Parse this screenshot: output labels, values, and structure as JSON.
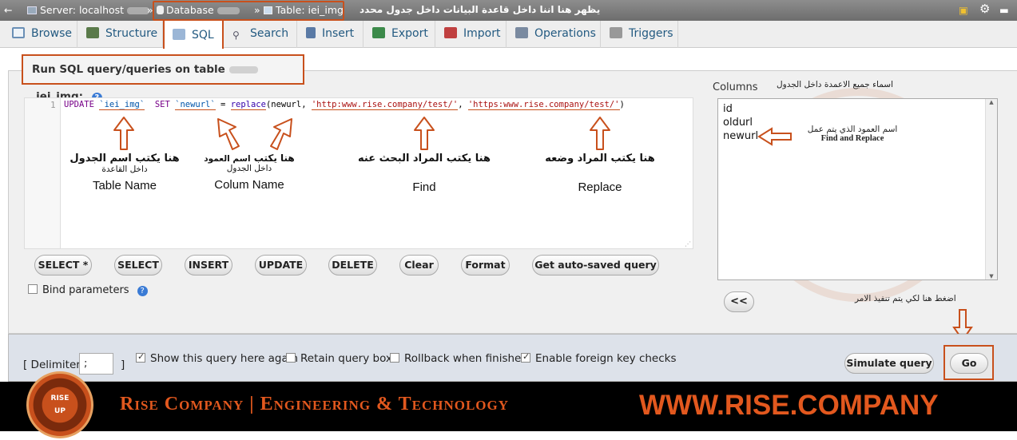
{
  "topbar": {
    "server": "Server: localhost",
    "database": "Database",
    "table": "Table: iei_img",
    "separator": "»",
    "arabic_note": "يظهر هنا اننا داخل قاعدة البيانات داخل جدول محدد"
  },
  "tabs": [
    {
      "label": "Browse",
      "icon": "browse-icon"
    },
    {
      "label": "Structure",
      "icon": "structure-icon"
    },
    {
      "label": "SQL",
      "icon": "sql-icon"
    },
    {
      "label": "Search",
      "icon": "search-icon"
    },
    {
      "label": "Insert",
      "icon": "insert-icon"
    },
    {
      "label": "Export",
      "icon": "export-icon"
    },
    {
      "label": "Import",
      "icon": "import-icon"
    },
    {
      "label": "Operations",
      "icon": "operations-icon"
    },
    {
      "label": "Triggers",
      "icon": "triggers-icon"
    }
  ],
  "active_tab": "SQL",
  "query": {
    "title_prefix": "Run SQL query/queries on table",
    "title_suffix": ".iei_img:",
    "line_number": "1",
    "code": {
      "kw_update": "UPDATE",
      "table": "`iei_img`",
      "kw_set": "SET",
      "column": "`newurl`",
      "eq": "=",
      "func": "replace",
      "arg_open": "(newurl,",
      "find": "'http:www.rise.company/test/'",
      "comma": ",",
      "replace_with": "'https:www.rise.company/test/'",
      "close": ")"
    }
  },
  "annotations": {
    "table": {
      "ar": "هنا يكتب اسم الجدول",
      "ar_sub": "داخل القاعدة",
      "en": "Table Name"
    },
    "column": {
      "ar_top": "اسم العمود",
      "ar": "هنا يكتب",
      "ar_sub": "داخل الجدول",
      "en": "Colum  Name"
    },
    "find": {
      "ar": "هنا يكتب المراد البحث عنه",
      "en": "Find"
    },
    "replace": {
      "ar": "هنا يكتب المراد وضعه",
      "en": "Replace"
    },
    "columns_header": "اسماء جميع الاعمدة داخل الجدول",
    "column_target_ar": "اسم العمود الذي يتم عمل",
    "column_target_en": "Find and Replace",
    "go_hint": "اضغط هنا لكي يتم تنفيذ الامر"
  },
  "buttons": {
    "select_star": "SELECT *",
    "select": "SELECT",
    "insert": "INSERT",
    "update": "UPDATE",
    "delete": "DELETE",
    "clear": "Clear",
    "format": "Format",
    "autosaved": "Get auto-saved query",
    "insert_column": "<<",
    "simulate": "Simulate query",
    "go": "Go"
  },
  "bind_parameters": {
    "label": "Bind parameters",
    "checked": false
  },
  "columns": {
    "label": "Columns",
    "items": [
      "id",
      "oldurl",
      "newurl"
    ]
  },
  "options": {
    "delimiter_label": "[ Delimiter",
    "delimiter_value": ";",
    "delimiter_close": "]",
    "show_query": {
      "label": "Show this query here again",
      "checked": true
    },
    "retain_box": {
      "label": "Retain query box",
      "checked": false
    },
    "rollback": {
      "label": "Rollback when finished",
      "checked": false
    },
    "foreign_keys": {
      "label": "Enable foreign key checks",
      "checked": true
    }
  },
  "banner": {
    "brand": "Rise Company | Engineering & Technology",
    "site": "WWW.RISE.COMPANY",
    "logo_top": "RISE",
    "logo_bottom": "UP"
  },
  "colors": {
    "highlight": "#c8501c",
    "brand_orange": "#e2581e",
    "link_blue": "#235a81"
  }
}
